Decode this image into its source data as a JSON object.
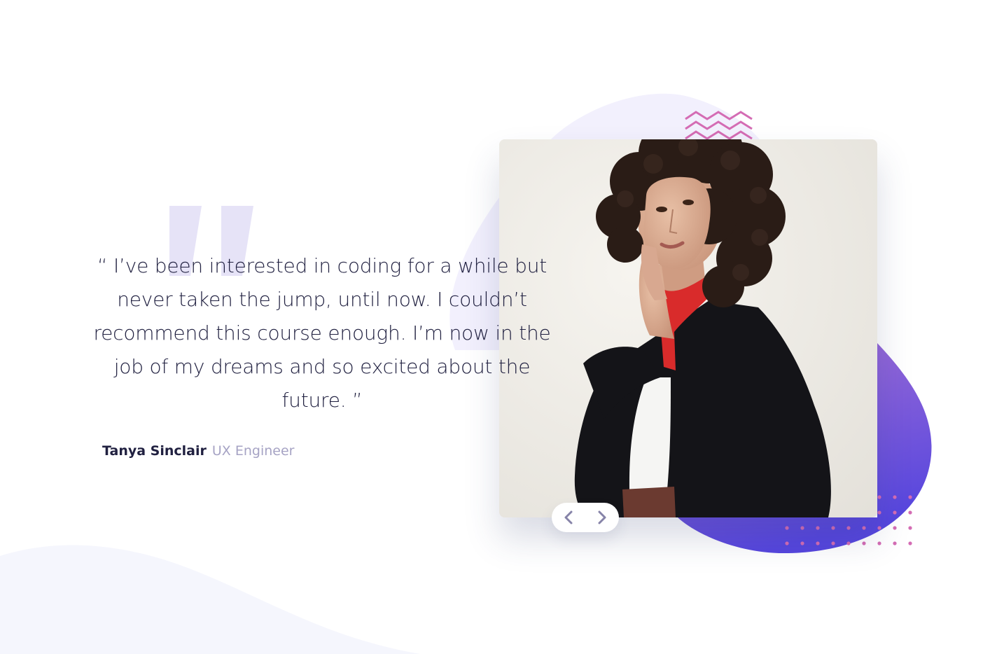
{
  "testimonial": {
    "quote": "“ I’ve been interested in coding for a while but never taken the jump, until now. I couldn’t recommend this course enough. I’m now in the job of my dreams and so excited about the future. ”",
    "author_name": "Tanya Sinclair",
    "author_role": "UX Engineer"
  },
  "controls": {
    "prev_icon": "chevron-left-icon",
    "next_icon": "chevron-right-icon"
  },
  "colors": {
    "text_dark": "#202040",
    "text_muted": "#a6a3c4",
    "quote_mark": "#e6e3f7",
    "blob_light": "#f2f0fd",
    "blob_purple_start": "#9d6ad6",
    "blob_purple_end": "#5a4be0",
    "accent_pink": "#d46cb4",
    "bg_wave": "#f5f6fd"
  },
  "icons": {
    "quote_mark": "double-quote-icon",
    "decorative_pattern": "zigzag-pattern-icon",
    "dot_grid": "dot-grid-icon"
  }
}
